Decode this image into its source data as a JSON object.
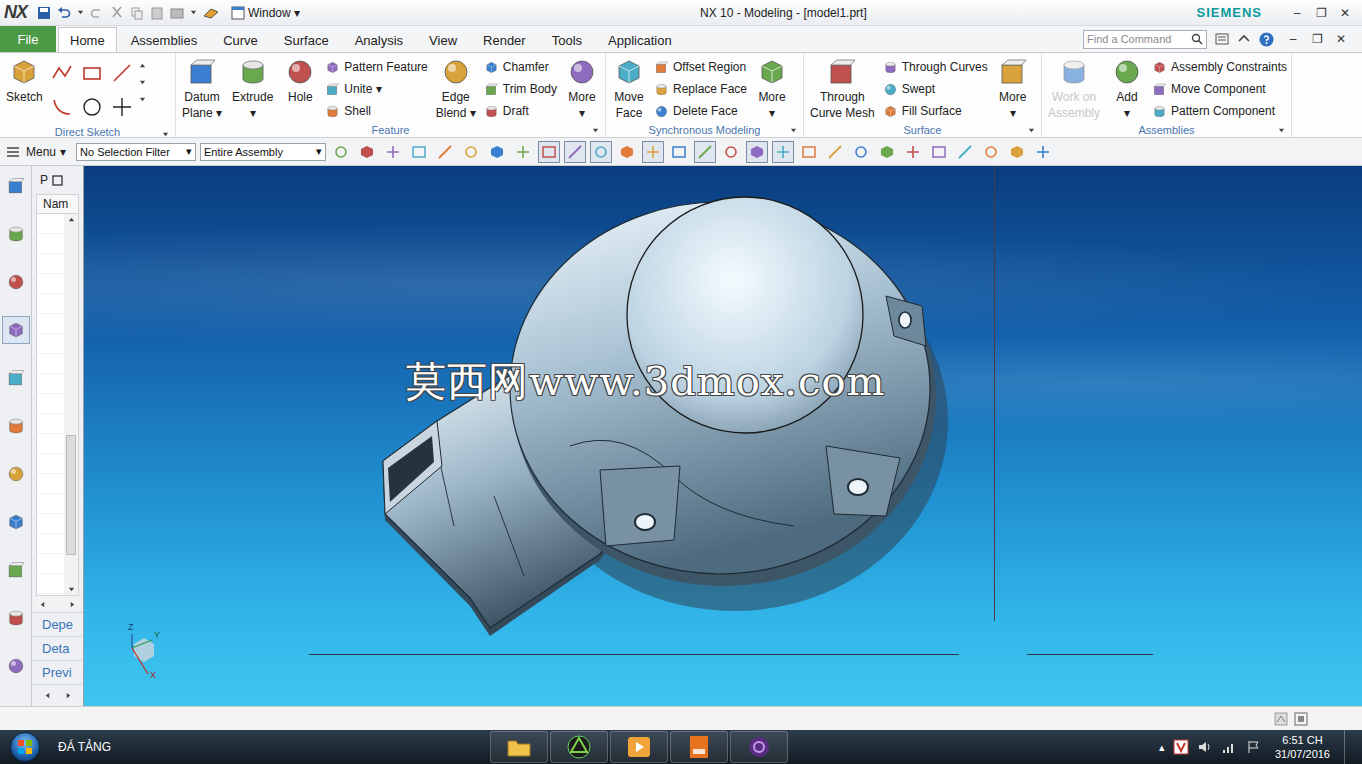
{
  "window": {
    "logo": "NX",
    "quick_menu": "Window",
    "quick_arrow": "▾",
    "title": "NX 10 - Modeling - [model1.prt]",
    "brand": "SIEMENS",
    "controls": [
      "–",
      "❐",
      "✕"
    ]
  },
  "tabs": [
    {
      "label": "File",
      "kind": "file",
      "selected": false
    },
    {
      "label": "Home",
      "kind": "tab",
      "selected": true
    },
    {
      "label": "Assemblies",
      "kind": "tab",
      "selected": false
    },
    {
      "label": "Curve",
      "kind": "tab",
      "selected": false
    },
    {
      "label": "Surface",
      "kind": "tab",
      "selected": false
    },
    {
      "label": "Analysis",
      "kind": "tab",
      "selected": false
    },
    {
      "label": "View",
      "kind": "tab",
      "selected": false
    },
    {
      "label": "Render",
      "kind": "tab",
      "selected": false
    },
    {
      "label": "Tools",
      "kind": "tab",
      "selected": false
    },
    {
      "label": "Application",
      "kind": "tab",
      "selected": false
    }
  ],
  "search": {
    "placeholder": "Find a Command"
  },
  "document_controls": [
    "–",
    "❐",
    "✕"
  ],
  "ribbon": [
    {
      "title": "Direct Sketch",
      "columns": [
        {
          "kind": "big",
          "lines": [
            "Sketch"
          ],
          "disabled": false
        },
        {
          "kind": "grid"
        }
      ]
    },
    {
      "title": "Feature",
      "columns": [
        {
          "kind": "big",
          "lines": [
            "Datum",
            "Plane"
          ],
          "arrow": "▾",
          "disabled": false
        },
        {
          "kind": "big",
          "lines": [
            "Extrude"
          ],
          "arrow": "▾",
          "disabled": false
        },
        {
          "kind": "big",
          "lines": [
            "Hole"
          ],
          "disabled": false
        },
        {
          "kind": "smalls",
          "items": [
            {
              "label": "Pattern Feature"
            },
            {
              "label": "Unite",
              "arrow": "▾"
            },
            {
              "label": "Shell"
            }
          ]
        },
        {
          "kind": "big",
          "lines": [
            "Edge",
            "Blend"
          ],
          "arrow": "▾",
          "disabled": false
        },
        {
          "kind": "smalls",
          "items": [
            {
              "label": "Chamfer"
            },
            {
              "label": "Trim Body"
            },
            {
              "label": "Draft"
            }
          ]
        },
        {
          "kind": "big",
          "lines": [
            "More"
          ],
          "arrow": "▾",
          "disabled": false
        }
      ]
    },
    {
      "title": "Synchronous Modeling",
      "columns": [
        {
          "kind": "big",
          "lines": [
            "Move",
            "Face"
          ],
          "disabled": false
        },
        {
          "kind": "smalls",
          "items": [
            {
              "label": "Offset Region"
            },
            {
              "label": "Replace Face"
            },
            {
              "label": "Delete Face"
            }
          ]
        },
        {
          "kind": "big",
          "lines": [
            "More"
          ],
          "arrow": "▾",
          "disabled": false
        }
      ]
    },
    {
      "title": "Surface",
      "columns": [
        {
          "kind": "big",
          "lines": [
            "Through",
            "Curve Mesh"
          ],
          "disabled": false
        },
        {
          "kind": "smalls",
          "items": [
            {
              "label": "Through Curves"
            },
            {
              "label": "Swept"
            },
            {
              "label": "Fill Surface"
            }
          ]
        },
        {
          "kind": "big",
          "lines": [
            "More"
          ],
          "arrow": "▾",
          "disabled": false
        }
      ]
    },
    {
      "title": "Assemblies",
      "columns": [
        {
          "kind": "big",
          "lines": [
            "Work on",
            "Assembly"
          ],
          "disabled": true
        },
        {
          "kind": "big",
          "lines": [
            "Add"
          ],
          "arrow": "▾",
          "disabled": false
        },
        {
          "kind": "smalls",
          "items": [
            {
              "label": "Assembly Constraints"
            },
            {
              "label": "Move Component"
            },
            {
              "label": "Pattern Component"
            }
          ]
        }
      ]
    }
  ],
  "toolbar": {
    "menu": "Menu",
    "menu_arrow": "▾",
    "selection_filter": "No Selection Filter",
    "scope": "Entire Assembly",
    "dropdown_arrow": "▾",
    "tools": [
      {
        "selected": false
      },
      {
        "selected": false
      },
      {
        "selected": false
      },
      {
        "selected": false
      },
      {
        "selected": false
      },
      {
        "selected": false
      },
      {
        "selected": false
      },
      {
        "selected": false
      },
      {
        "selected": true
      },
      {
        "selected": true
      },
      {
        "selected": true
      },
      {
        "selected": false
      },
      {
        "selected": true
      },
      {
        "selected": false
      },
      {
        "selected": true
      },
      {
        "selected": false
      },
      {
        "selected": true
      },
      {
        "selected": true
      },
      {
        "selected": false
      },
      {
        "selected": false
      },
      {
        "selected": false
      },
      {
        "selected": false
      },
      {
        "selected": false
      },
      {
        "selected": false
      },
      {
        "selected": false
      },
      {
        "selected": false
      },
      {
        "selected": false
      },
      {
        "selected": false
      }
    ]
  },
  "resource_bar": [
    {
      "selected": false
    },
    {
      "selected": false
    },
    {
      "selected": false
    },
    {
      "selected": true
    },
    {
      "selected": false
    },
    {
      "selected": false
    },
    {
      "selected": false
    },
    {
      "selected": false
    },
    {
      "selected": false
    },
    {
      "selected": false
    },
    {
      "selected": false
    }
  ],
  "navigator": {
    "header": "P",
    "column": "Nam",
    "tabs": [
      "Depe",
      "Deta",
      "Previ"
    ]
  },
  "viewport": {
    "watermark": "莫西网www.3dmox.com",
    "triad": {
      "z": "Z",
      "y": "Y",
      "x": "X"
    }
  },
  "taskbar": {
    "user": "ĐÁ TẢNG",
    "apps": [
      {
        "selected": false
      },
      {
        "selected": false
      },
      {
        "selected": false
      },
      {
        "selected": false
      },
      {
        "selected": false
      }
    ],
    "tray_arrow": "▴",
    "time": "6:51 CH",
    "date": "31/07/2016"
  }
}
